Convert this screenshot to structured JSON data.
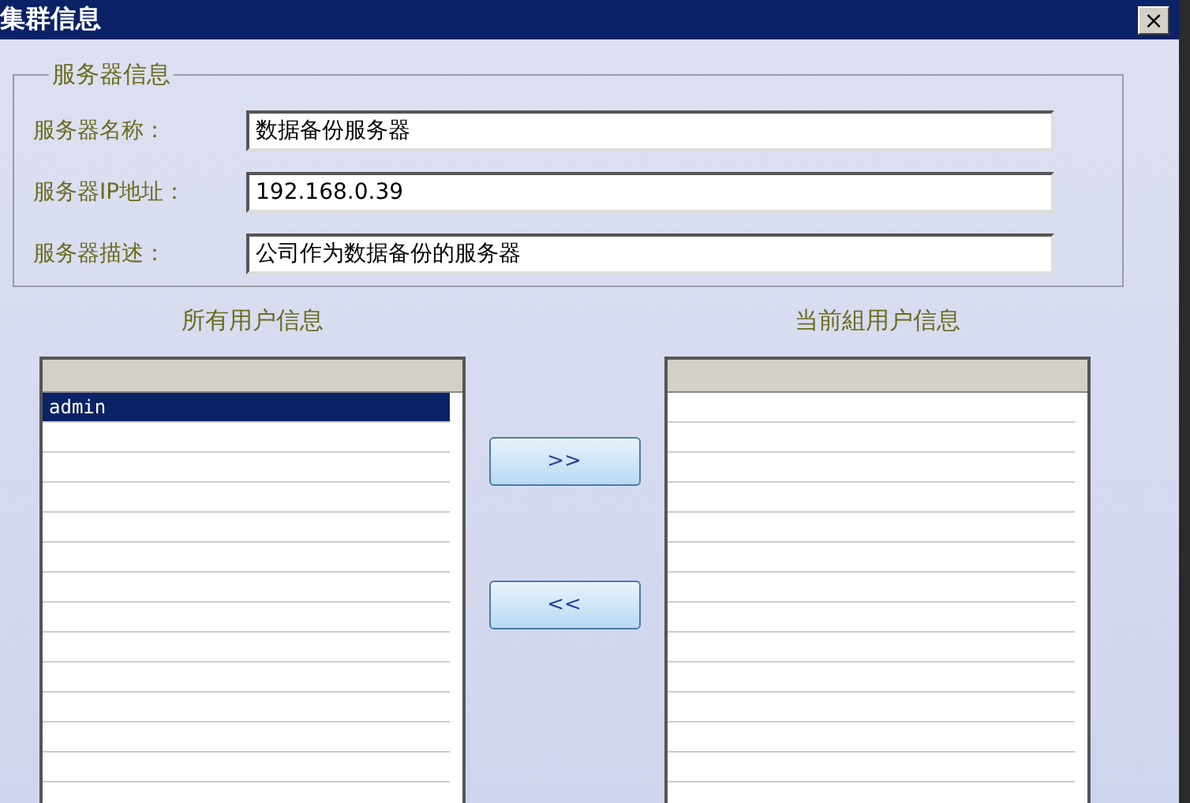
{
  "window": {
    "title": "集群信息",
    "close": "×"
  },
  "server_info": {
    "legend": "服务器信息",
    "fields": [
      {
        "label": "服务器名称：",
        "value": "数据备份服务器"
      },
      {
        "label": "服务器IP地址：",
        "value": "192.168.0.39"
      },
      {
        "label": "服务器描述：",
        "value": "公司作为数据备份的服务器"
      }
    ]
  },
  "all_users": {
    "title": "所有用户信息",
    "rows": [
      {
        "name": "admin",
        "selected": true
      }
    ]
  },
  "buttons": [
    ">>",
    "<<"
  ],
  "group_users": {
    "title": "当前組用户信息"
  }
}
